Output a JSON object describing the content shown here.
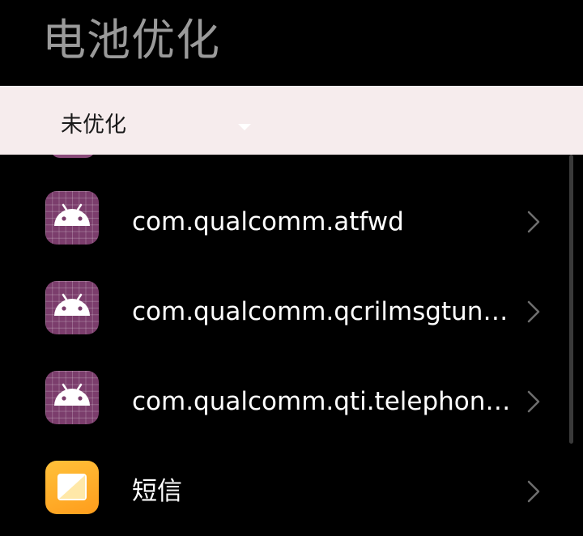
{
  "header": {
    "title": "电池优化"
  },
  "filter": {
    "selected": "未优化"
  },
  "apps": [
    {
      "name": "com.qualcomm.atfwd",
      "icon": "android-icon"
    },
    {
      "name": "com.qualcomm.qcrilmsgtun…",
      "icon": "android-icon"
    },
    {
      "name": "com.qualcomm.qti.telephon…",
      "icon": "android-icon"
    },
    {
      "name": "短信",
      "icon": "messages-icon"
    }
  ],
  "colors": {
    "background": "#000000",
    "filter_bar": "#f6eced",
    "android_icon_bg": "#7b3d6c",
    "messages_icon": "#ffb02e"
  }
}
